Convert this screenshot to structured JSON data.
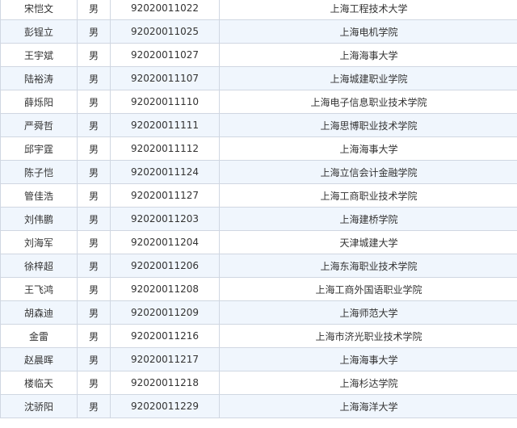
{
  "table": {
    "rows": [
      {
        "name": "宋恺文",
        "gender": "男",
        "id": "92020011022",
        "school": "上海工程技术大学"
      },
      {
        "name": "彭锃立",
        "gender": "男",
        "id": "92020011025",
        "school": "上海电机学院"
      },
      {
        "name": "王宇斌",
        "gender": "男",
        "id": "92020011027",
        "school": "上海海事大学"
      },
      {
        "name": "陆裕涛",
        "gender": "男",
        "id": "92020011107",
        "school": "上海城建职业学院"
      },
      {
        "name": "薛烁阳",
        "gender": "男",
        "id": "92020011110",
        "school": "上海电子信息职业技术学院"
      },
      {
        "name": "严舜哲",
        "gender": "男",
        "id": "92020011111",
        "school": "上海思博职业技术学院"
      },
      {
        "name": "邱宇霆",
        "gender": "男",
        "id": "92020011112",
        "school": "上海海事大学"
      },
      {
        "name": "陈子恺",
        "gender": "男",
        "id": "92020011124",
        "school": "上海立信会计金融学院"
      },
      {
        "name": "管佳浩",
        "gender": "男",
        "id": "92020011127",
        "school": "上海工商职业技术学院"
      },
      {
        "name": "刘伟鹏",
        "gender": "男",
        "id": "92020011203",
        "school": "上海建桥学院"
      },
      {
        "name": "刘海军",
        "gender": "男",
        "id": "92020011204",
        "school": "天津城建大学"
      },
      {
        "name": "徐梓超",
        "gender": "男",
        "id": "92020011206",
        "school": "上海东海职业技术学院"
      },
      {
        "name": "王飞鸿",
        "gender": "男",
        "id": "92020011208",
        "school": "上海工商外国语职业学院"
      },
      {
        "name": "胡森迪",
        "gender": "男",
        "id": "92020011209",
        "school": "上海师范大学"
      },
      {
        "name": "金雷",
        "gender": "男",
        "id": "92020011216",
        "school": "上海市济光职业技术学院"
      },
      {
        "name": "赵晨晖",
        "gender": "男",
        "id": "92020011217",
        "school": "上海海事大学"
      },
      {
        "name": "楼临天",
        "gender": "男",
        "id": "92020011218",
        "school": "上海杉达学院"
      },
      {
        "name": "沈骄阳",
        "gender": "男",
        "id": "92020011229",
        "school": "上海海洋大学"
      }
    ]
  }
}
